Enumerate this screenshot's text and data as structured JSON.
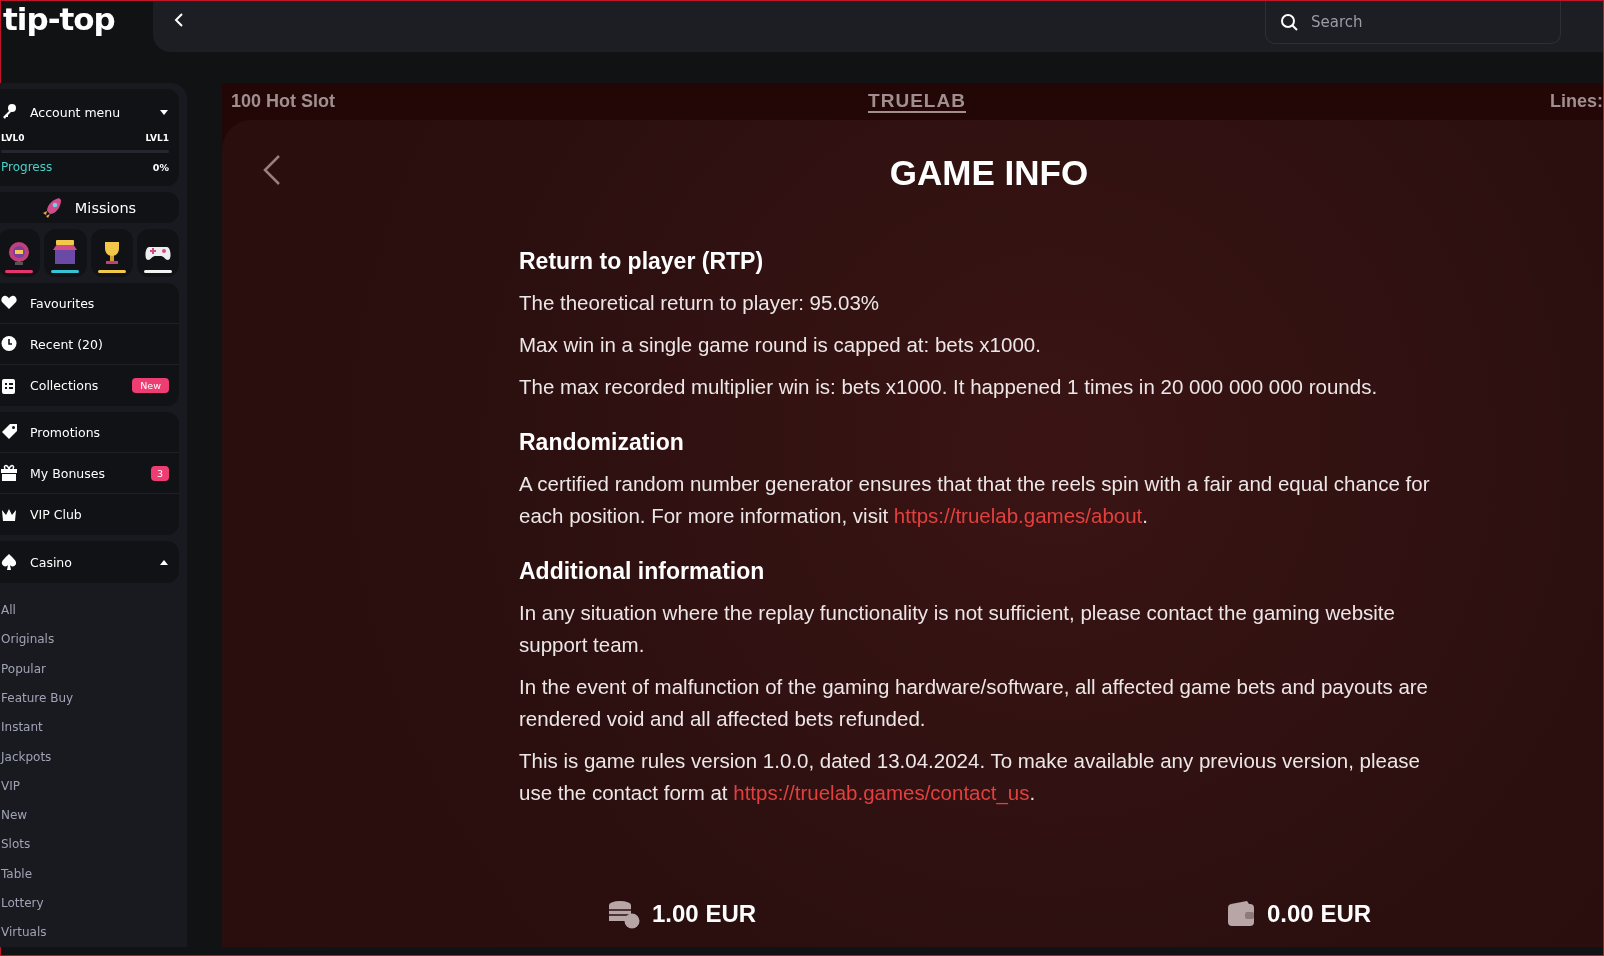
{
  "logo": "tip-top",
  "search": {
    "placeholder": "Search"
  },
  "sidebar": {
    "account": {
      "label": "Account menu",
      "expanded": false,
      "level_from": "LVL0",
      "level_to": "LVL1",
      "progress_label": "Progress",
      "progress_value": "0%",
      "level": 0
    },
    "missions": {
      "label": "Missions"
    },
    "shortcuts": [
      {
        "kind": "wheel",
        "color": "#e8336d"
      },
      {
        "kind": "store",
        "color": "#35c4d6"
      },
      {
        "kind": "trophy",
        "color": "#f2c84b"
      },
      {
        "kind": "gamepad",
        "color": "#f2f2f2"
      }
    ],
    "groups": [
      [
        {
          "kind": "heart",
          "label": "Favourites"
        },
        {
          "kind": "clock",
          "label": "Recent (20)"
        },
        {
          "kind": "clipboard",
          "label": "Collections",
          "badge": "New"
        }
      ],
      [
        {
          "kind": "tag",
          "label": "Promotions"
        },
        {
          "kind": "gift",
          "label": "My Bonuses",
          "badge": "3"
        },
        {
          "kind": "crown",
          "label": "VIP Club"
        }
      ]
    ],
    "casino": {
      "label": "Casino",
      "expanded": true,
      "items": [
        "All",
        "Originals",
        "Popular",
        "Feature Buy",
        "Instant",
        "Jackpots",
        "VIP",
        "New",
        "Slots",
        "Table",
        "Lottery",
        "Virtuals"
      ]
    }
  },
  "game": {
    "title": "100 Hot Slot",
    "provider": "TRUELAB",
    "header_right": "Lines:",
    "heading": "GAME INFO",
    "sections": [
      {
        "title": "Return to player (RTP)",
        "paragraphs": [
          [
            {
              "text": "The theoretical return to player: 95.03%"
            }
          ],
          [
            {
              "text": "Max win in a single game round is capped at: bets x1000."
            }
          ],
          [
            {
              "text": "The max recorded multiplier win is: bets x1000. It happened 1 times in 20 000 000 000 rounds."
            }
          ]
        ]
      },
      {
        "title": "Randomization",
        "paragraphs": [
          [
            {
              "text": "A certified random number generator ensures that that the reels spin with a fair and equal chance for each position. For more information, visit "
            },
            {
              "text": "https://truelab.games/about",
              "kind": "link"
            },
            {
              "text": "."
            }
          ]
        ]
      },
      {
        "title": "Additional information",
        "paragraphs": [
          [
            {
              "text": "In any situation where the replay functionality is not sufficient, please contact the gaming website support team."
            }
          ],
          [
            {
              "text": "In the event of malfunction of the gaming hardware/software, all affected game bets and payouts are rendered void and all affected bets refunded."
            }
          ],
          [
            {
              "text": "This is game rules version 1.0.0, dated 13.04.2024. To make available any previous version, please use the contact form at "
            },
            {
              "text": "https://truelab.games/contact_us",
              "kind": "link"
            },
            {
              "text": "."
            }
          ]
        ]
      }
    ],
    "bet": "1.00 EUR",
    "balance": "0.00 EUR"
  }
}
